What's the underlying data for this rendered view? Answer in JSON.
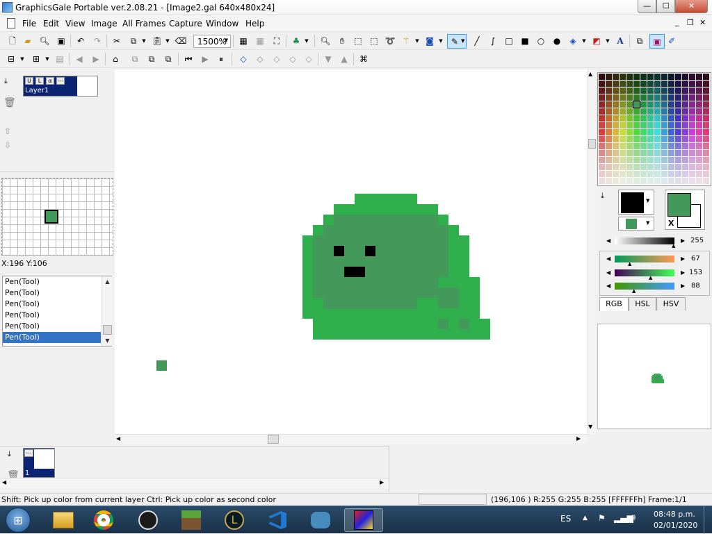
{
  "window": {
    "title": "GraphicsGale Portable ver.2.08.21 - [Image2.gal 640x480x24]",
    "minimize": "—",
    "maximize": "☐",
    "close": "✕",
    "mdi_min": "_",
    "mdi_restore": "❐",
    "mdi_close": "✕"
  },
  "menu": [
    "File",
    "Edit",
    "View",
    "Image",
    "All Frames",
    "Capture",
    "Window",
    "Help"
  ],
  "toolbar": {
    "zoom_value": "1500%"
  },
  "layers": {
    "layer_name": "Layer1"
  },
  "cursor_readout": "X:196 Y:106",
  "history": {
    "items": [
      "Pen(Tool)",
      "Pen(Tool)",
      "Pen(Tool)",
      "Pen(Tool)",
      "Pen(Tool)",
      "Pen(Tool)"
    ],
    "selected_index": 5
  },
  "frames": {
    "frame_number": "1"
  },
  "colors": {
    "primary": "#000000",
    "secondary": "#43995a",
    "current": "#43995a",
    "values": {
      "rgb_top": "255",
      "r": "67",
      "g": "153",
      "b": "88"
    },
    "swap_label": "X"
  },
  "color_tabs": [
    "RGB",
    "HSL",
    "HSV"
  ],
  "status": {
    "hint": "Shift: Pick up color from current layer  Ctrl: Pick up color as second color",
    "pixel_info": "(196,106 ) R:255 G:255 B:255  [FFFFFFh]  Frame:1/1"
  },
  "taskbar": {
    "language": "ES",
    "time": "08:48 p.m.",
    "date": "02/01/2020"
  },
  "palette_colors": {
    "slime_light": "#2fb04c",
    "slime_dark": "#43995a",
    "accent": "#3372c4"
  }
}
